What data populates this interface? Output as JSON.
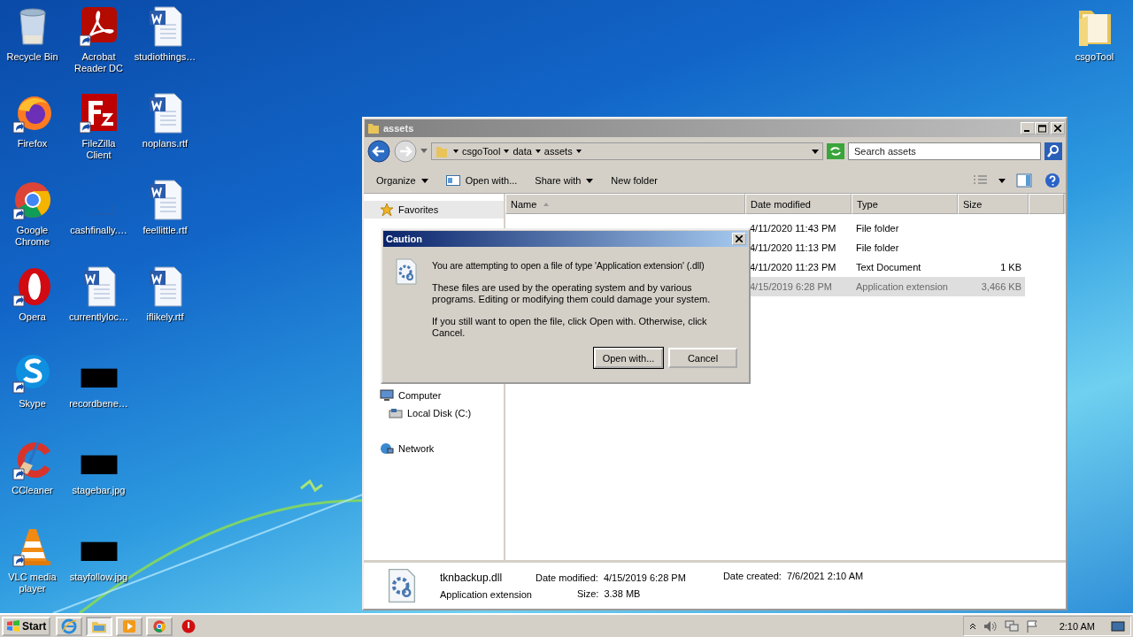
{
  "desktop_icons": [
    {
      "label": "Recycle Bin",
      "kind": "recycle",
      "shortcut": false
    },
    {
      "label": "Firefox",
      "kind": "firefox",
      "shortcut": true
    },
    {
      "label": "Google Chrome",
      "kind": "chrome",
      "shortcut": true
    },
    {
      "label": "Opera",
      "kind": "opera",
      "shortcut": true
    },
    {
      "label": "Skype",
      "kind": "skype",
      "shortcut": true
    },
    {
      "label": "CCleaner",
      "kind": "ccleaner",
      "shortcut": true
    },
    {
      "label": "VLC media player",
      "kind": "vlc",
      "shortcut": true
    },
    {
      "label": "Acrobat Reader DC",
      "kind": "acrobat",
      "shortcut": true
    },
    {
      "label": "FileZilla Client",
      "kind": "filezilla",
      "shortcut": true
    },
    {
      "label": "cashfinally.…",
      "kind": "blank",
      "shortcut": false
    },
    {
      "label": "currentlyloc…",
      "kind": "word",
      "shortcut": false
    },
    {
      "label": "recordbene…",
      "kind": "image",
      "shortcut": false
    },
    {
      "label": "stagebar.jpg",
      "kind": "image",
      "shortcut": false
    },
    {
      "label": "stayfollow.jpg",
      "kind": "image",
      "shortcut": false
    },
    {
      "label": "studiothings…",
      "kind": "word",
      "shortcut": false
    },
    {
      "label": "noplans.rtf",
      "kind": "word",
      "shortcut": false
    },
    {
      "label": "feellittle.rtf",
      "kind": "word",
      "shortcut": false
    },
    {
      "label": "iflikely.rtf",
      "kind": "word",
      "shortcut": false
    }
  ],
  "corner_icon": {
    "label": "csgoTool",
    "kind": "folder",
    "shortcut": false
  },
  "explorer": {
    "title": "assets",
    "breadcrumb": [
      "csgoTool",
      "data",
      "assets"
    ],
    "search": {
      "placeholder": "Search assets"
    },
    "toolbar": [
      {
        "label": "Organize",
        "dropdown": true
      },
      {
        "label": "Open with...",
        "dropdown": false
      },
      {
        "label": "Share with",
        "dropdown": true
      },
      {
        "label": "New folder",
        "dropdown": false
      }
    ],
    "nav": [
      {
        "label": "Favorites",
        "kind": "star",
        "selected": true
      },
      {
        "label": "Computer",
        "kind": "computer",
        "selected": false,
        "children": [
          {
            "label": "Local Disk (C:)",
            "kind": "disk",
            "selected": false
          }
        ]
      },
      {
        "label": "Network",
        "kind": "network",
        "selected": false
      }
    ],
    "columns": [
      "Name",
      "Date modified",
      "Type",
      "Size"
    ],
    "rows": [
      {
        "date": "4/11/2020 11:43 PM",
        "type": "File folder",
        "size": "",
        "selected": false
      },
      {
        "date": "4/11/2020 11:13 PM",
        "type": "File folder",
        "size": "",
        "selected": false
      },
      {
        "date": "4/11/2020 11:23 PM",
        "type": "Text Document",
        "size": "1 KB",
        "selected": false
      },
      {
        "date": "4/15/2019 6:28 PM",
        "type": "Application extension",
        "size": "3,466 KB",
        "selected": true
      }
    ],
    "details": {
      "name": "tknbackup.dll",
      "type": "Application extension",
      "modified_label": "Date modified:",
      "modified": "4/15/2019 6:28 PM",
      "size_label": "Size:",
      "size": "3.38 MB",
      "created_label": "Date created:",
      "created": "7/6/2021 2:10 AM"
    }
  },
  "dialog": {
    "title": "Caution",
    "message": "You are attempting to open a file of type 'Application extension' (.dll)",
    "paragraphs": [
      "These files are used by the operating system and by various programs. Editing or modifying them could damage your system.",
      "If you still want to open the file, click Open with. Otherwise, click Cancel."
    ],
    "buttons": [
      {
        "label": "Open with...",
        "default": true
      },
      {
        "label": "Cancel",
        "default": false
      }
    ]
  },
  "taskbar": {
    "start": "Start",
    "items": [
      {
        "kind": "ie",
        "selected": false
      },
      {
        "kind": "explorer",
        "selected": true
      },
      {
        "kind": "media",
        "selected": false
      },
      {
        "kind": "chrome",
        "selected": false
      },
      {
        "kind": "stop",
        "selected": false
      }
    ],
    "clock": "2:10 AM"
  }
}
